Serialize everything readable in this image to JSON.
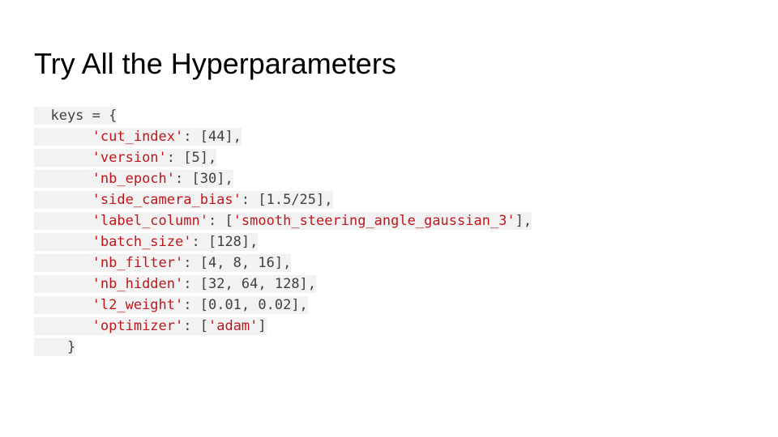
{
  "slide": {
    "title": "Try All the Hyperparameters"
  },
  "code": {
    "open_line": "  keys = {",
    "close_line": "    }",
    "entries": [
      {
        "key": "'cut_index'",
        "value": "[44],"
      },
      {
        "key": "'version'",
        "value": "[5],"
      },
      {
        "key": "'nb_epoch'",
        "value": "[30],"
      },
      {
        "key": "'side_camera_bias'",
        "value": "[1.5/25],"
      },
      {
        "key": "'label_column'",
        "value_prefix": "[",
        "value_str": "'smooth_steering_angle_gaussian_3'",
        "value_suffix": "],"
      },
      {
        "key": "'batch_size'",
        "value": "[128],"
      },
      {
        "key": "'nb_filter'",
        "value": "[4, 8, 16],"
      },
      {
        "key": "'nb_hidden'",
        "value": "[32, 64, 128],"
      },
      {
        "key": "'l2_weight'",
        "value": "[0.01, 0.02],"
      },
      {
        "key": "'optimizer'",
        "value_prefix": "[",
        "value_str": "'adam'",
        "value_suffix": "]"
      }
    ],
    "indent": "       ",
    "separator": ": "
  },
  "colors": {
    "string": "#c0171d",
    "text": "#404040",
    "highlight_bg": "#f2f2f2"
  }
}
